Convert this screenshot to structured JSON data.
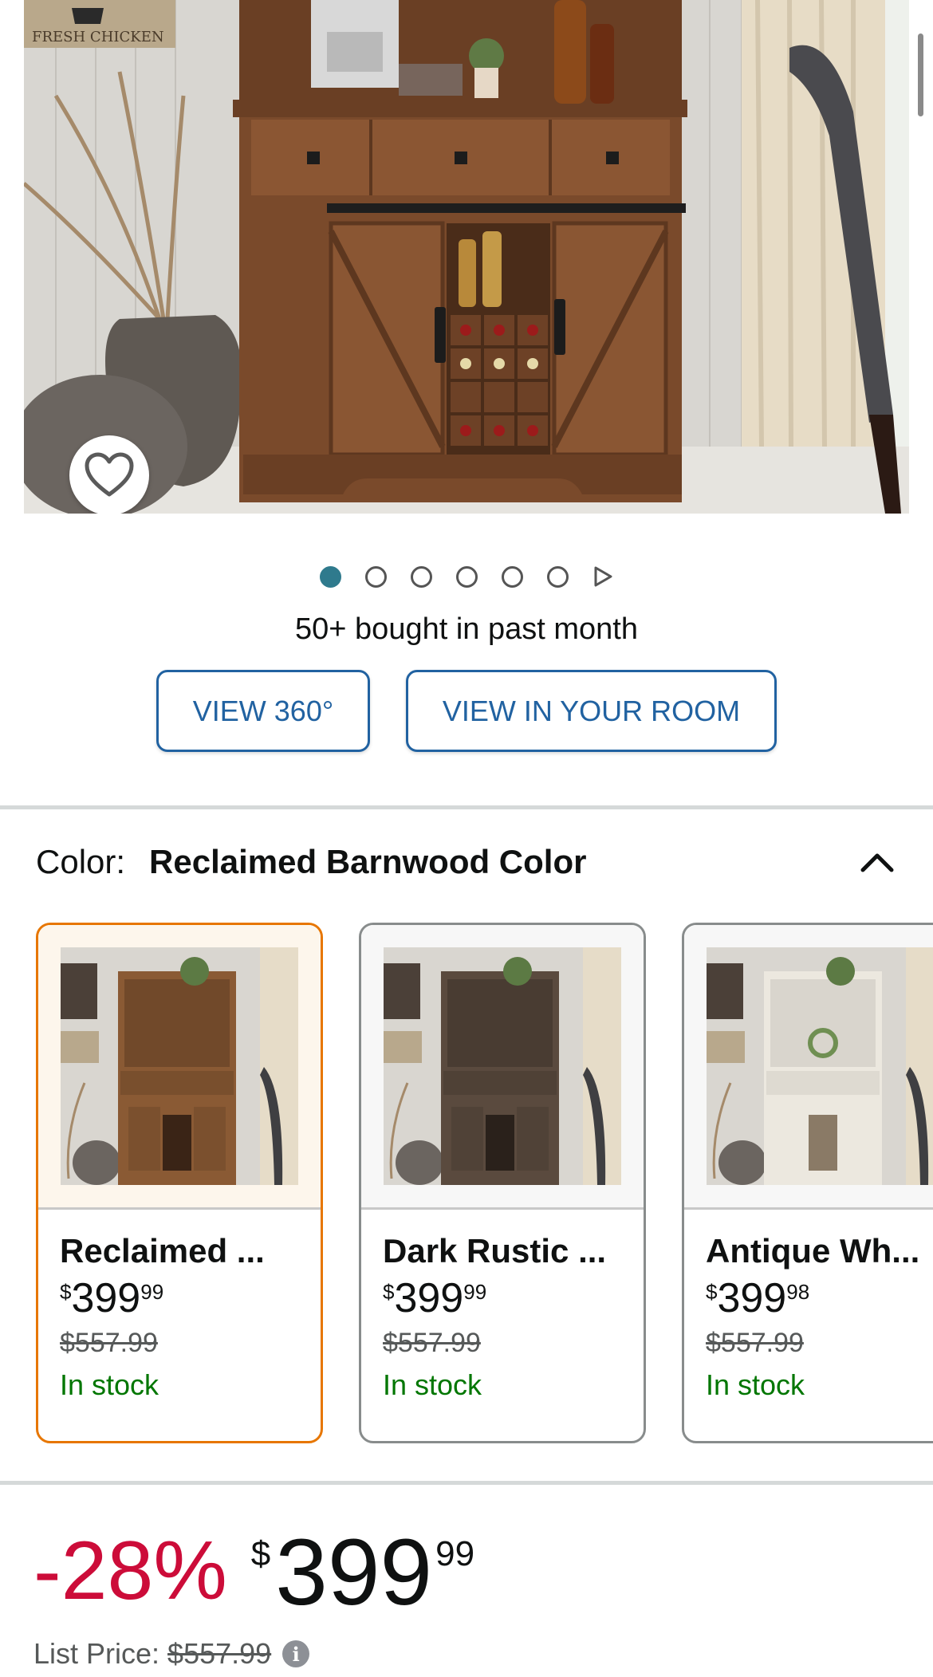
{
  "hero": {
    "sign_text": "FRESH CHICKEN",
    "wishlist_icon": "heart-outline-icon"
  },
  "carousel": {
    "total_dots": 6,
    "active_index": 0,
    "next_icon": "play-triangle-icon"
  },
  "social_proof": "50+ bought in past month",
  "view_buttons": {
    "view_360": "VIEW 360°",
    "view_in_room": "VIEW IN YOUR ROOM"
  },
  "color": {
    "label": "Color:",
    "selected": "Reclaimed Barnwood Color",
    "collapse_icon": "chevron-up-icon"
  },
  "swatches": [
    {
      "name": "Reclaimed ...",
      "currency": "$",
      "price_whole": "399",
      "price_fraction": "99",
      "list_price": "$557.99",
      "stock": "In stock",
      "finish_color": "#8a5a34"
    },
    {
      "name": "Dark Rustic ...",
      "currency": "$",
      "price_whole": "399",
      "price_fraction": "99",
      "list_price": "$557.99",
      "stock": "In stock",
      "finish_color": "#5a4a3e"
    },
    {
      "name": "Antique Wh...",
      "currency": "$",
      "price_whole": "399",
      "price_fraction": "98",
      "list_price": "$557.99",
      "stock": "In stock",
      "finish_color": "#ece8df"
    }
  ],
  "price": {
    "discount": "-28%",
    "currency": "$",
    "whole": "399",
    "fraction": "99",
    "list_label": "List Price:",
    "list_value": "$557.99",
    "info_icon": "info-circle-icon"
  },
  "colors": {
    "link_blue": "#2162a1",
    "deal_red": "#cc0c39",
    "stock_green": "#007600",
    "selected_border": "#e77600",
    "dot_active": "#2f7a8d"
  }
}
